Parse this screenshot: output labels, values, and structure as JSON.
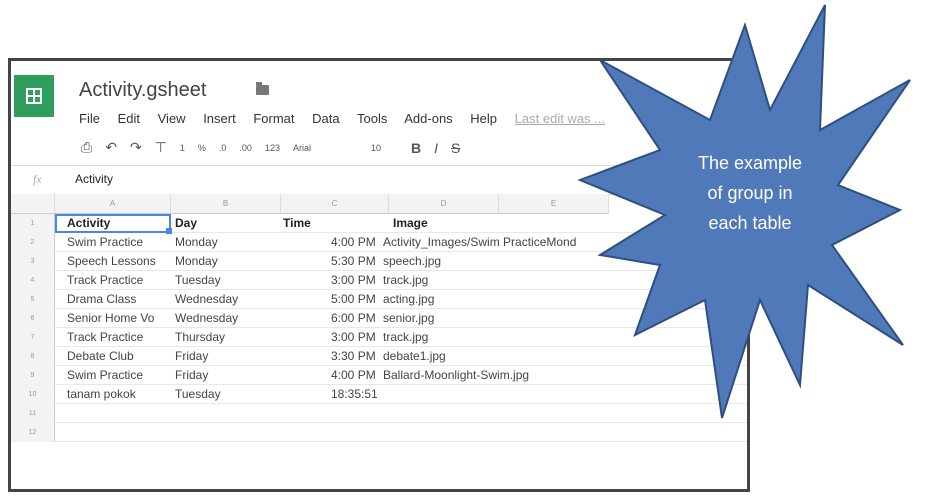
{
  "app": {
    "title": "Activity.gsheet",
    "menu": [
      "File",
      "Edit",
      "View",
      "Insert",
      "Format",
      "Data",
      "Tools",
      "Add-ons",
      "Help"
    ],
    "last_edit": "Last edit was ...",
    "toolbar": {
      "font_name": "Arial",
      "font_size": "10",
      "percent": "%",
      "decimal_dec": ".0",
      "decimal_inc": ".00",
      "more_formats": "123",
      "one": "1"
    }
  },
  "formula_bar": {
    "fx_label": "fx",
    "value": "Activity"
  },
  "sheet": {
    "columns": [
      "A",
      "B",
      "C",
      "D",
      "E"
    ],
    "row_numbers": [
      "1",
      "2",
      "3",
      "4",
      "5",
      "6",
      "7",
      "8",
      "9",
      "10",
      "11",
      "12"
    ],
    "header": [
      "Activity",
      "Day",
      "Time",
      "Image"
    ],
    "rows": [
      [
        "Swim Practice",
        "Monday",
        "4:00 PM",
        "Activity_Images/Swim PracticeMond"
      ],
      [
        "Speech Lessons",
        "Monday",
        "5:30 PM",
        "speech.jpg"
      ],
      [
        "Track Practice",
        "Tuesday",
        "3:00 PM",
        "track.jpg"
      ],
      [
        "Drama Class",
        "Wednesday",
        "5:00 PM",
        "acting.jpg"
      ],
      [
        "Senior Home Vo",
        "Wednesday",
        "6:00 PM",
        "senior.jpg"
      ],
      [
        "Track Practice",
        "Thursday",
        "3:00 PM",
        "track.jpg"
      ],
      [
        "Debate Club",
        "Friday",
        "3:30 PM",
        "debate1.jpg"
      ],
      [
        "Swim Practice",
        "Friday",
        "4:00 PM",
        "Ballard-Moonlight-Swim.jpg"
      ],
      [
        "tanam pokok",
        "Tuesday",
        "18:35:51",
        ""
      ]
    ]
  },
  "callout": {
    "line1": "The example",
    "line2": "of group in",
    "line3": "each table",
    "fill": "#4f79b8"
  }
}
